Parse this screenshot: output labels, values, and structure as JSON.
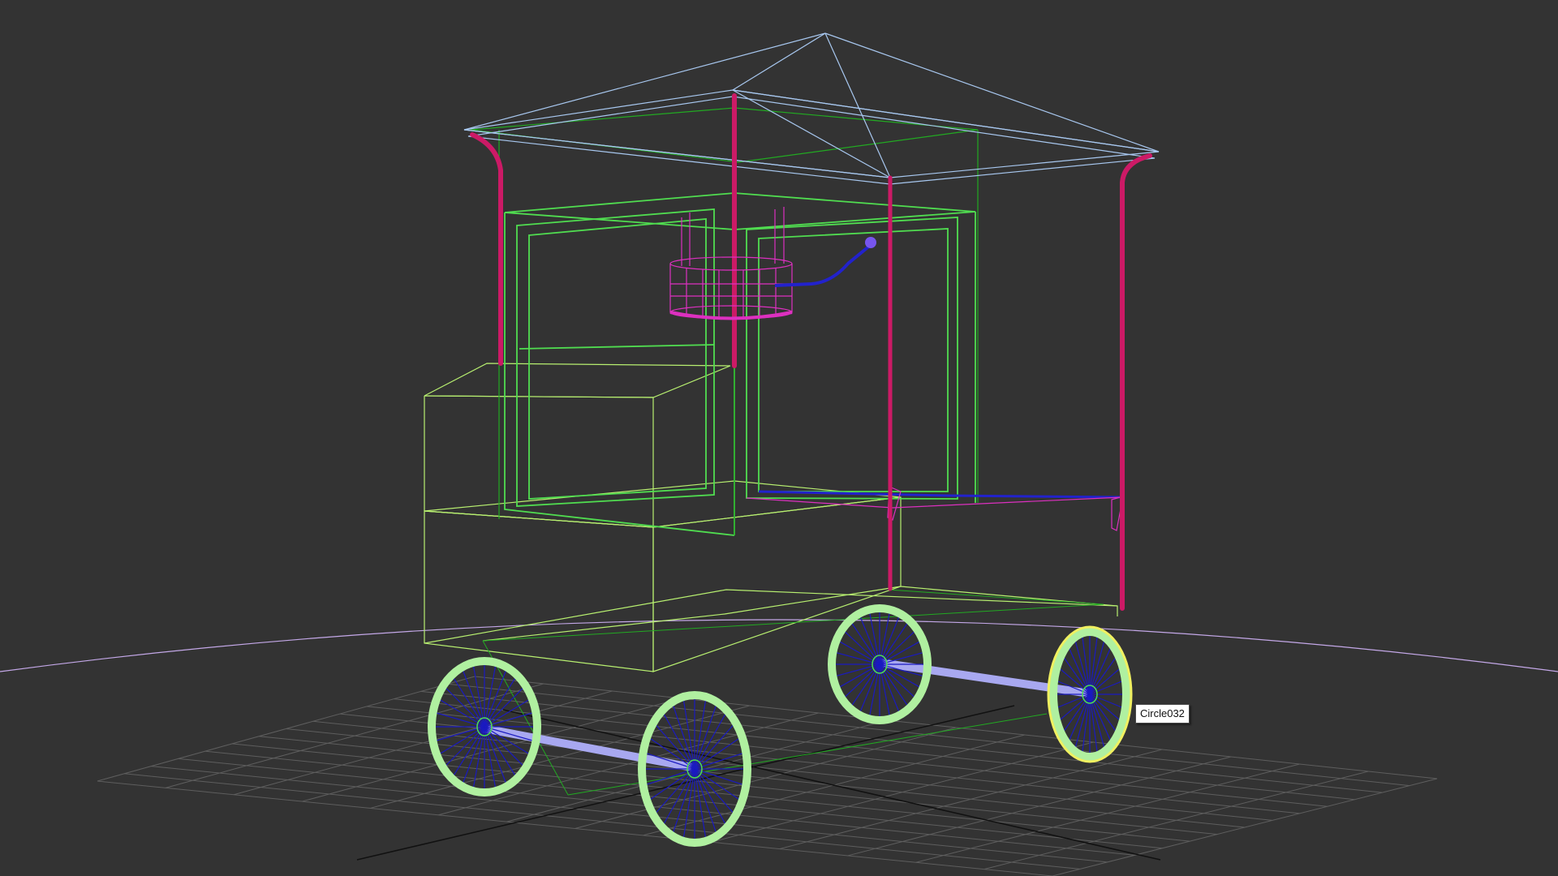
{
  "viewport": {
    "background": "#333333",
    "hover_tooltip": {
      "object_name": "Circle032"
    },
    "colors": {
      "grid": "#5e5e5e",
      "grid_axis": "#111111",
      "horizon": "#c4a8e8",
      "roof": "#a8c8f0",
      "body_light_green": "#b8f070",
      "panel_green": "#50dd50",
      "dark_green": "#22aa22",
      "posts": "#cc1a66",
      "basket": "#dd30c0",
      "handle": "#2222cc",
      "spokes": "#1a1ac0",
      "rims": "#b0f0a0",
      "axles": "#a8a8f0",
      "selected_rim": "#f0f060"
    },
    "objects": [
      "roof",
      "corner-posts",
      "display-cabinet",
      "counter-box",
      "cart-base",
      "basket",
      "handle",
      "shelf-rail",
      "front-left-wheel",
      "front-right-wheel",
      "rear-left-wheel",
      "rear-right-wheel",
      "front-axle",
      "rear-axle"
    ]
  }
}
